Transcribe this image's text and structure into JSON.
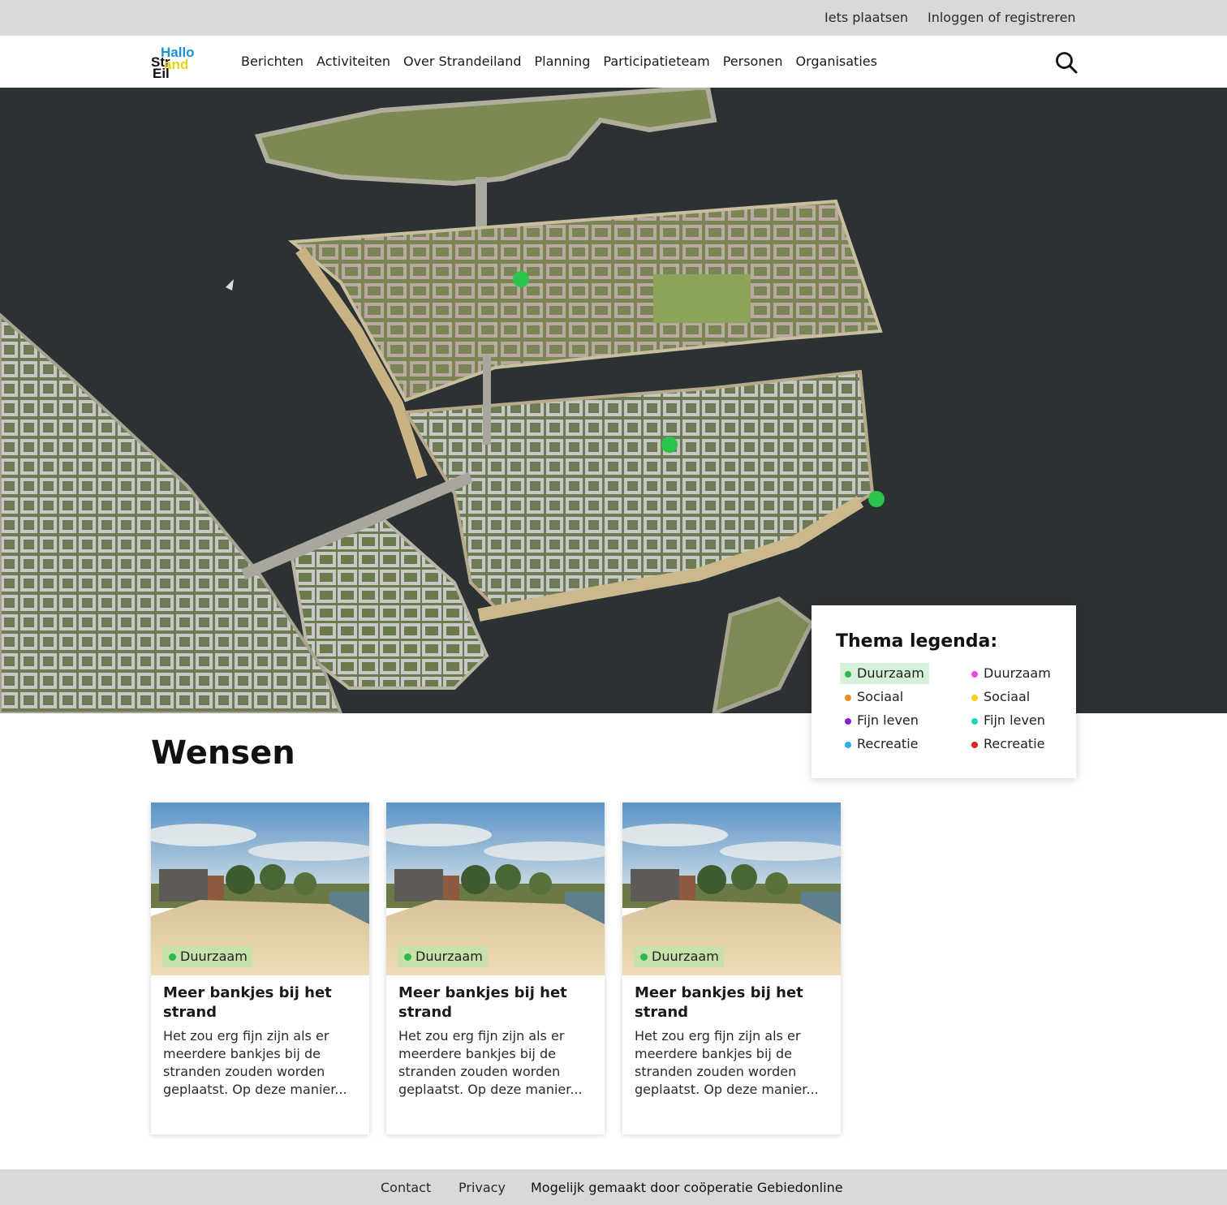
{
  "topbar": {
    "post_label": "Iets plaatsen",
    "login_label": "Inloggen of registreren"
  },
  "logo": {
    "line1": "Hallo",
    "line2": "Str",
    "line2b": "and",
    "line3": "Eil"
  },
  "nav": {
    "items": [
      "Berichten",
      "Activiteiten",
      "Over Strandeiland",
      "Planning",
      "Participatieteam",
      "Personen",
      "Organisaties"
    ]
  },
  "header": {
    "search_icon": "search-icon"
  },
  "map": {
    "markers": [
      {
        "theme": "Duurzaam",
        "color": "#2bc44a"
      },
      {
        "theme": "Duurzaam",
        "color": "#2bc44a"
      },
      {
        "theme": "Duurzaam",
        "color": "#2bc44a"
      }
    ]
  },
  "legend": {
    "title": "Thema legenda:",
    "items": [
      {
        "label": "Duurzaam",
        "color": "#2bb94a",
        "active": true
      },
      {
        "label": "Duurzaam",
        "color": "#e84be0",
        "active": false
      },
      {
        "label": "Sociaal",
        "color": "#e8921e",
        "active": false
      },
      {
        "label": "Sociaal",
        "color": "#f2cf1d",
        "active": false
      },
      {
        "label": "Fijn leven",
        "color": "#8a22c9",
        "active": false
      },
      {
        "label": "Fijn leven",
        "color": "#21d6b5",
        "active": false
      },
      {
        "label": "Recreatie",
        "color": "#22b6e4",
        "active": false
      },
      {
        "label": "Recreatie",
        "color": "#e2231a",
        "active": false
      }
    ]
  },
  "section": {
    "title": "Wensen"
  },
  "cards": [
    {
      "badge": "Duurzaam",
      "title": "Meer bankjes bij het strand",
      "excerpt": "Het zou erg fijn zijn als er meerdere bankjes bij de stranden zouden worden geplaatst. Op deze manier..."
    },
    {
      "badge": "Duurzaam",
      "title": "Meer bankjes bij het strand",
      "excerpt": "Het zou erg fijn zijn als er meerdere bankjes bij de stranden zouden worden geplaatst. Op deze manier..."
    },
    {
      "badge": "Duurzaam",
      "title": "Meer bankjes bij het strand",
      "excerpt": "Het zou erg fijn zijn als er meerdere bankjes bij de stranden zouden worden geplaatst. Op deze manier..."
    }
  ],
  "footer": {
    "contact": "Contact",
    "privacy": "Privacy",
    "credit": "Mogelijk gemaakt door coöperatie Gebiedonline"
  }
}
